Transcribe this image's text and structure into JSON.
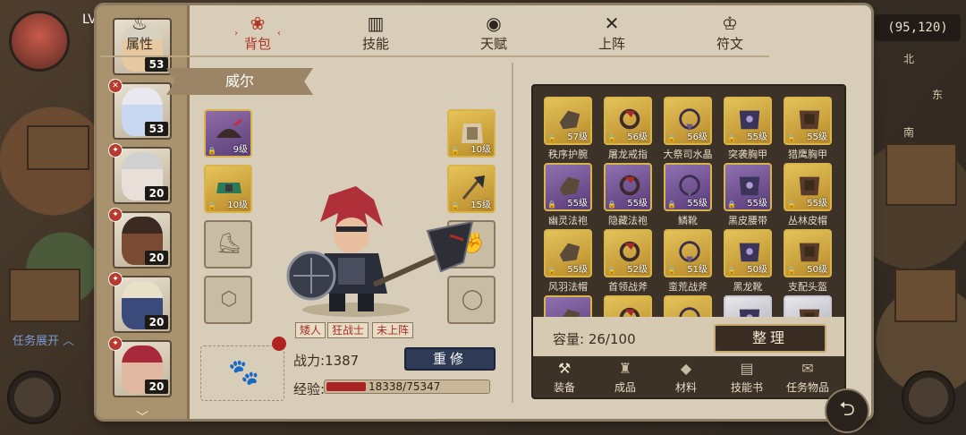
{
  "hud": {
    "level_label": "LV",
    "coords": "(95,120)",
    "compass": {
      "north": "北",
      "east": "东",
      "south": "南"
    },
    "task_expand": "任务展开"
  },
  "hero_list": {
    "heroes": [
      {
        "level": "53",
        "face_color": "#e8c8a0",
        "hair_color": "#d8d0c0",
        "badge": ""
      },
      {
        "level": "53",
        "face_color": "#c8d8f0",
        "hair_color": "#e8e8f0",
        "badge": "✕"
      },
      {
        "level": "20",
        "face_color": "#e8e0d8",
        "hair_color": "#d0d0d0",
        "badge": "✦"
      },
      {
        "level": "20",
        "face_color": "#7a4a32",
        "hair_color": "#3a2a22",
        "badge": "✦"
      },
      {
        "level": "20",
        "face_color": "#3a4a7a",
        "hair_color": "#e8e0c8",
        "badge": "✦"
      },
      {
        "level": "20",
        "face_color": "#e0b8a0",
        "hair_color": "#a82a3a",
        "badge": "✦"
      }
    ]
  },
  "tabs": [
    {
      "label": "属性",
      "icon": "flame-icon",
      "active": false
    },
    {
      "label": "背包",
      "icon": "bag-icon",
      "active": true
    },
    {
      "label": "技能",
      "icon": "book-icon",
      "active": false
    },
    {
      "label": "天赋",
      "icon": "eye-icon",
      "active": false
    },
    {
      "label": "上阵",
      "icon": "swords-icon",
      "active": false
    },
    {
      "label": "符文",
      "icon": "rune-icon",
      "active": false
    }
  ],
  "hero": {
    "name": "威尔",
    "tags": [
      "矮人",
      "狂战士",
      "未上阵"
    ],
    "power_label": "战力:1387",
    "rebuild_label": "重修",
    "exp_label": "经验:",
    "exp_text": "18338/75347",
    "exp_current": 18338,
    "exp_max": 75347
  },
  "equip_slots": {
    "left": [
      {
        "type": "helmet",
        "level": "9级",
        "rarity": "purple"
      },
      {
        "type": "belt",
        "level": "10级",
        "rarity": "gold"
      },
      {
        "type": "boots",
        "level": "",
        "rarity": "empty"
      },
      {
        "type": "ring",
        "level": "",
        "rarity": "empty"
      }
    ],
    "right": [
      {
        "type": "armor",
        "level": "10级",
        "rarity": "gold"
      },
      {
        "type": "axe",
        "level": "15级",
        "rarity": "gold"
      },
      {
        "type": "gloves",
        "level": "",
        "rarity": "empty"
      },
      {
        "type": "necklace",
        "level": "",
        "rarity": "empty"
      }
    ]
  },
  "inventory": {
    "items": [
      {
        "name": "秩序护腕",
        "level": "57级",
        "color": "gold"
      },
      {
        "name": "屠龙戒指",
        "level": "56级",
        "color": "gold"
      },
      {
        "name": "大祭司水晶",
        "level": "56级",
        "color": "gold"
      },
      {
        "name": "突袭胸甲",
        "level": "55级",
        "color": "gold"
      },
      {
        "name": "猎鹰胸甲",
        "level": "55级",
        "color": "gold"
      },
      {
        "name": "幽灵法袍",
        "level": "55级",
        "color": "purple"
      },
      {
        "name": "隐藏法袍",
        "level": "55级",
        "color": "purple"
      },
      {
        "name": "鳞靴",
        "level": "55级",
        "color": "purple"
      },
      {
        "name": "黑皮腰带",
        "level": "55级",
        "color": "purple"
      },
      {
        "name": "丛林皮帽",
        "level": "55级",
        "color": "gold"
      },
      {
        "name": "风羽法帽",
        "level": "55级",
        "color": "gold"
      },
      {
        "name": "首领战斧",
        "level": "52级",
        "color": "gold"
      },
      {
        "name": "蛮荒战斧",
        "level": "51级",
        "color": "gold"
      },
      {
        "name": "黑龙靴",
        "level": "50级",
        "color": "gold"
      },
      {
        "name": "支配头盔",
        "level": "50级",
        "color": "gold"
      },
      {
        "name": "",
        "level": "",
        "color": "purple"
      },
      {
        "name": "",
        "level": "",
        "color": "gold"
      },
      {
        "name": "",
        "level": "",
        "color": "gold"
      },
      {
        "name": "",
        "level": "",
        "color": "white"
      },
      {
        "name": "",
        "level": "",
        "color": "white"
      }
    ],
    "capacity_label": "容量:",
    "capacity_value": "26/100",
    "sort_label": "整理",
    "tabs": [
      {
        "label": "装备",
        "icon": "anvil-icon",
        "active": true
      },
      {
        "label": "成品",
        "icon": "pouch-icon",
        "active": false
      },
      {
        "label": "材料",
        "icon": "ore-icon",
        "active": false
      },
      {
        "label": "技能书",
        "icon": "scroll-icon",
        "active": false
      },
      {
        "label": "任务物品",
        "icon": "quest-icon",
        "active": false
      }
    ]
  }
}
